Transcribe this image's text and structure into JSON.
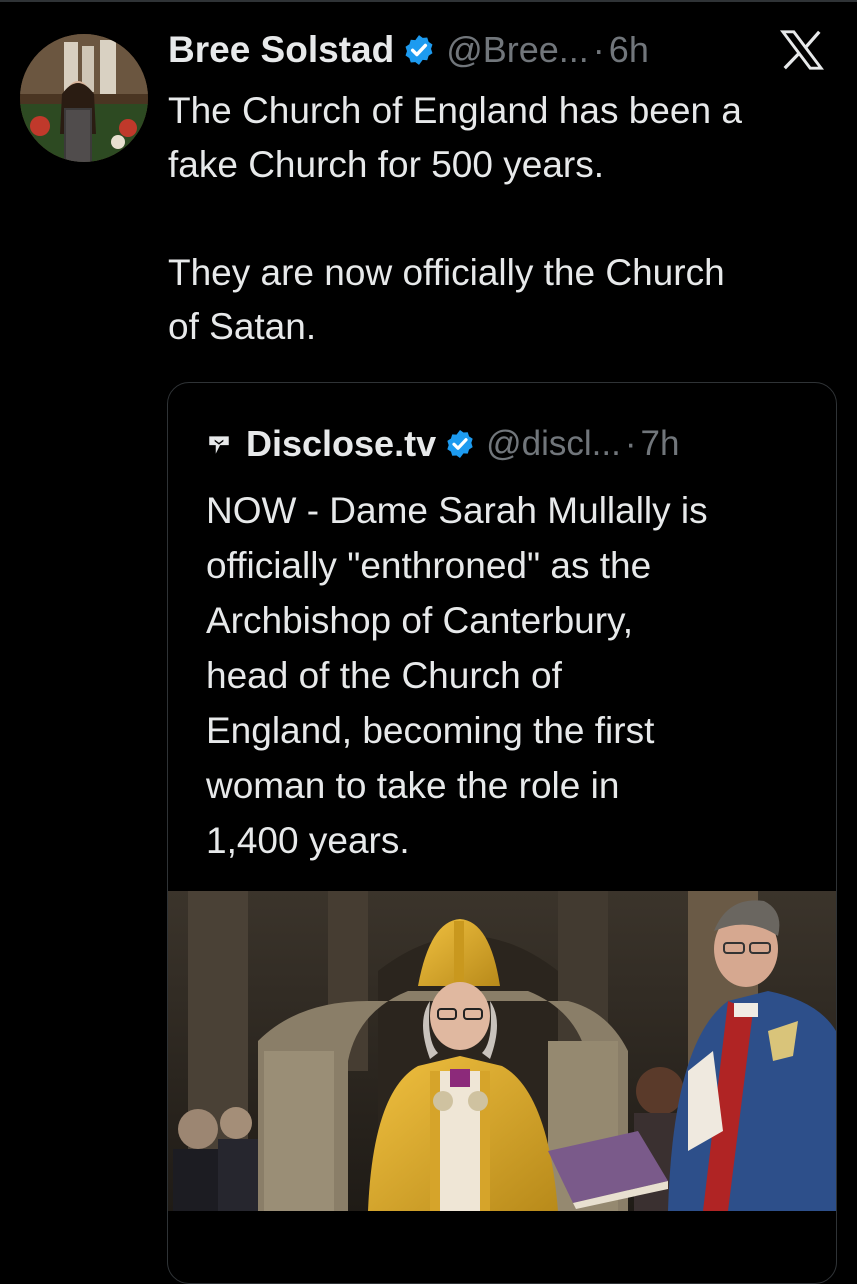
{
  "tweet": {
    "author_name": "Bree Solstad",
    "handle": "@Bree...",
    "time": "6h",
    "separator": "·",
    "text": "The Church of England has been a\nfake Church for 500 years.\n\nThey are now officially the Church\nof Satan.",
    "verified_icon": "verified-badge-icon",
    "close_icon": "x-logo-icon"
  },
  "quoted_tweet": {
    "author_name": "Disclose.tv",
    "handle": "@discl...",
    "time": "7h",
    "separator": "·",
    "text": "NOW - Dame Sarah Mullally is\nofficially \"enthroned\" as the\nArchbishop of Canterbury,\nhead of the Church of\nEngland, becoming the first\nwoman to take the role in\n1,400 years.",
    "logo_icon": "disclose-logo-icon"
  },
  "colors": {
    "background": "#000000",
    "text": "#e7e9ea",
    "secondary": "#71767b",
    "verified": "#1d9bf0",
    "border": "#2f3336"
  }
}
